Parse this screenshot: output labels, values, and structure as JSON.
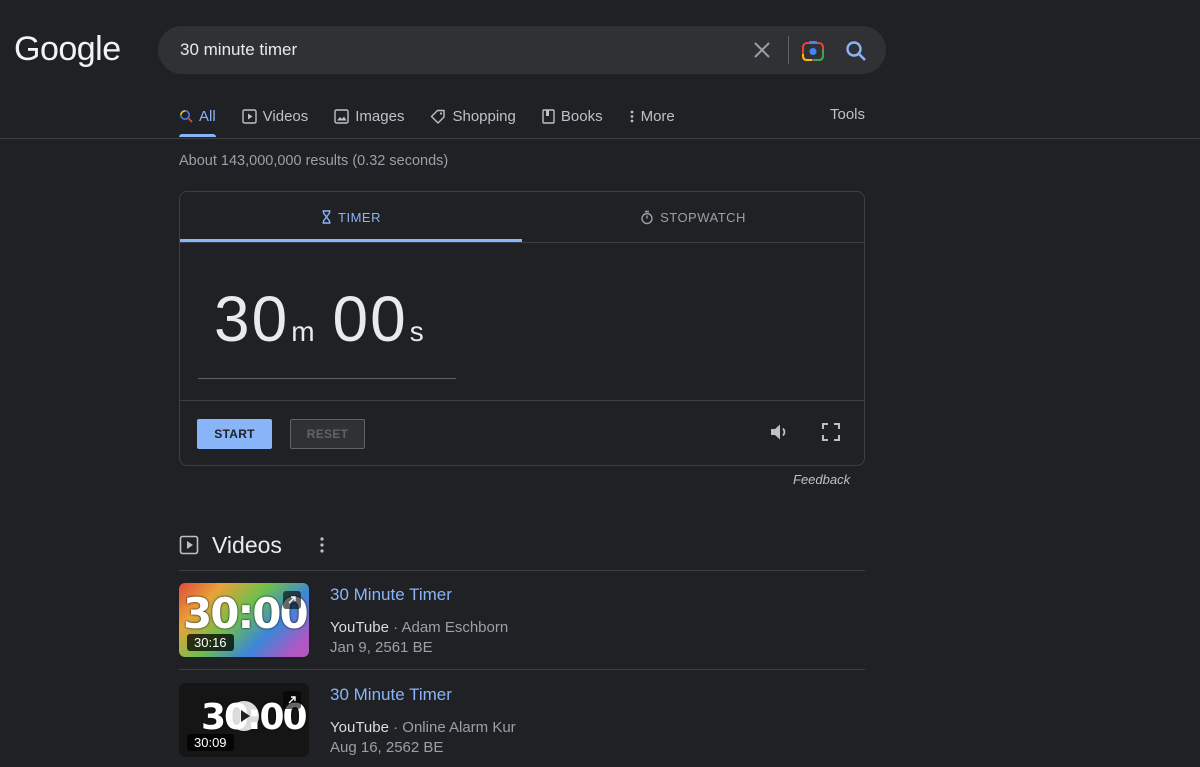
{
  "logo": "Google",
  "search": {
    "query": "30 minute timer"
  },
  "tabs": [
    {
      "label": "All",
      "icon": "search-icon"
    },
    {
      "label": "Videos",
      "icon": "video-icon"
    },
    {
      "label": "Images",
      "icon": "image-icon"
    },
    {
      "label": "Shopping",
      "icon": "tag-icon"
    },
    {
      "label": "Books",
      "icon": "book-icon"
    },
    {
      "label": "More",
      "icon": "more-vert-icon"
    }
  ],
  "tools_label": "Tools",
  "result_stats": "About 143,000,000 results (0.32 seconds)",
  "timer": {
    "tab_timer": "TIMER",
    "tab_stopwatch": "STOPWATCH",
    "minutes": "30",
    "minutes_unit": "m",
    "seconds": "00",
    "seconds_unit": "s",
    "start_label": "START",
    "reset_label": "RESET",
    "feedback": "Feedback"
  },
  "videos": {
    "heading": "Videos",
    "items": [
      {
        "title": "30 Minute Timer",
        "source": "YouTube",
        "author": "Adam Eschborn",
        "date": "Jan 9, 2561 BE",
        "duration": "30:16",
        "thumb_text": "30:00"
      },
      {
        "title": "30 Minute Timer",
        "source": "YouTube",
        "author": "Online Alarm Kur",
        "date": "Aug 16, 2562 BE",
        "duration": "30:09",
        "thumb_text": "30:00"
      }
    ]
  },
  "colors": {
    "background": "#202124",
    "accent": "#8ab4f8",
    "text": "#e8eaed",
    "muted": "#9aa0a6"
  }
}
